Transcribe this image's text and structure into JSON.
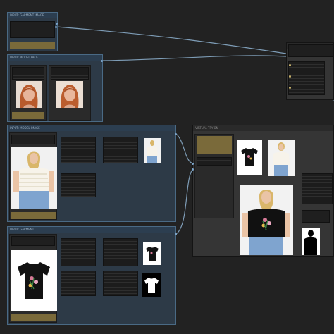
{
  "nodes": {
    "load_garment_image": {
      "title": "INPUT: GARMENT IMAGE"
    },
    "model_images": {
      "title": "INPUT: MODEL FACE"
    },
    "person_image": {
      "title": "INPUT: MODEL IMAGE"
    },
    "garment_item": {
      "title": "INPUT: GARMENT"
    },
    "tryon_node": {
      "title": "VIRTUAL TRY-ON"
    },
    "top_right_node": {
      "title": ""
    }
  },
  "colors": {
    "canvas": "#222222",
    "node_body": "#353535",
    "group_blue": "#2d3a47",
    "link": "#8fb3d1",
    "accent_gold": "#7a6a3a"
  },
  "icons": [
    "woman-face-photo",
    "tshirt-with-flowers",
    "white-tshirt-mask",
    "black-silhouette-mask"
  ]
}
